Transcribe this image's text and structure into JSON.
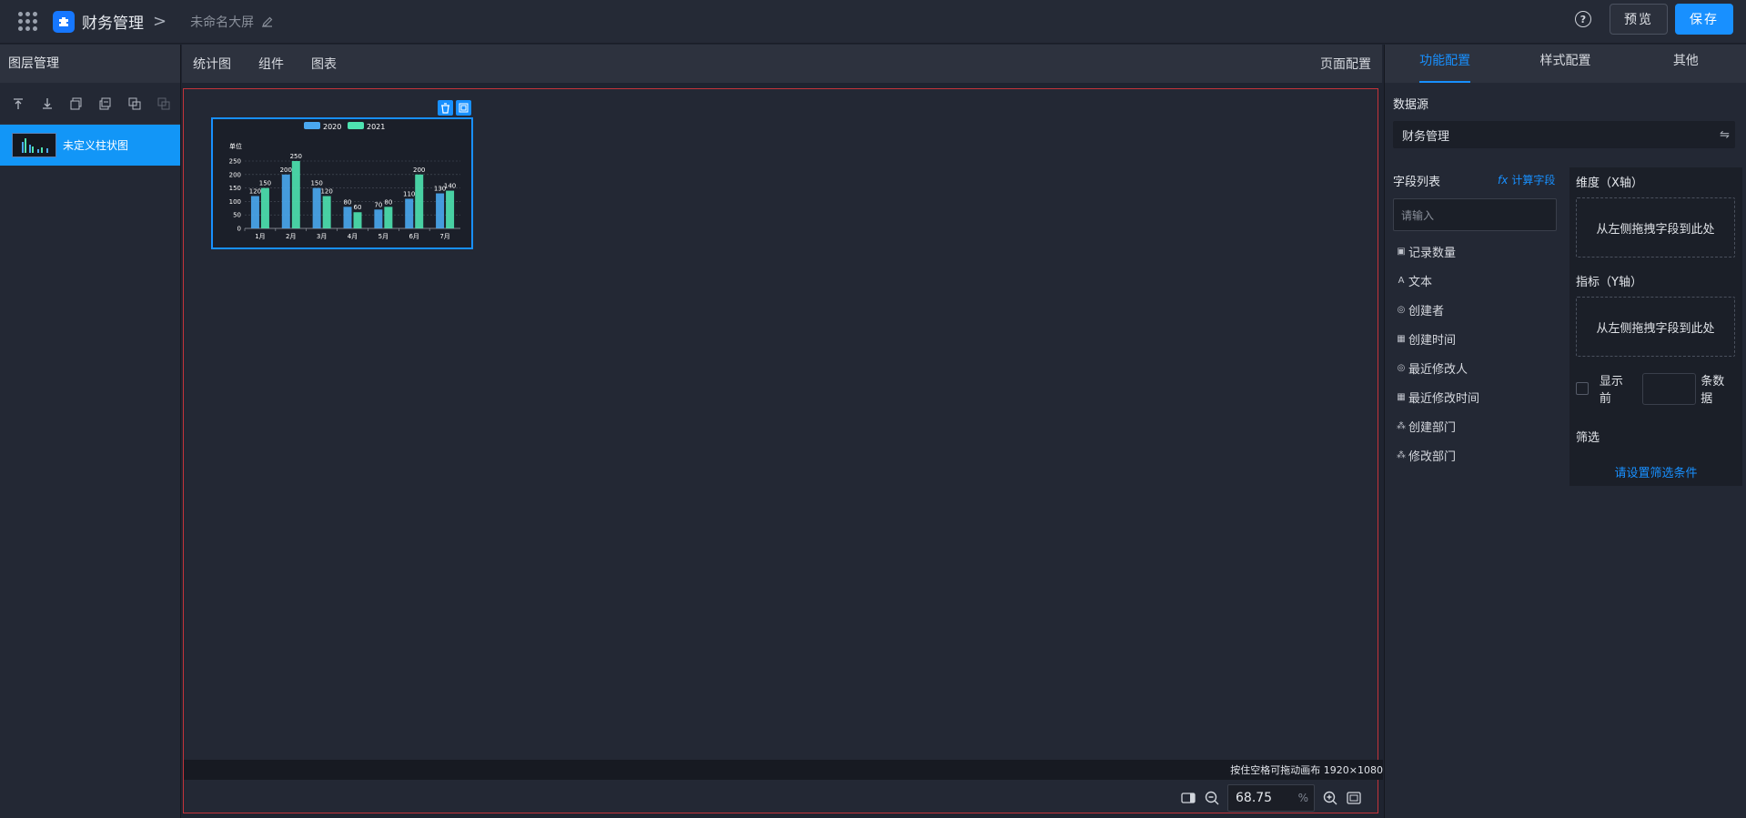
{
  "header": {
    "app_name": "财务管理",
    "screen_name": "未命名大屏",
    "preview_label": "预览",
    "save_label": "保存",
    "help_glyph": "?"
  },
  "left_panel": {
    "title": "图层管理",
    "layers": [
      {
        "name": "未定义柱状图"
      }
    ]
  },
  "center": {
    "tabs": [
      "统计图",
      "组件",
      "图表"
    ],
    "page_config_label": "页面配置",
    "status_text": "按住空格可拖动画布 1920×1080",
    "zoom_value": "68.75",
    "zoom_unit": "%"
  },
  "right_panel": {
    "tabs": [
      "功能配置",
      "样式配置",
      "其他"
    ],
    "active_tab": "功能配置",
    "datasource_label": "数据源",
    "datasource_value": "财务管理",
    "field_list_title": "字段列表",
    "calc_field_label": "计算字段",
    "calc_field_prefix": "fx",
    "search_placeholder": "请输入",
    "fields": [
      {
        "label": "记录数量",
        "icon": "count-icon"
      },
      {
        "label": "文本",
        "icon": "text-icon"
      },
      {
        "label": "创建者",
        "icon": "user-icon"
      },
      {
        "label": "创建时间",
        "icon": "calendar-icon"
      },
      {
        "label": "最近修改人",
        "icon": "user-icon"
      },
      {
        "label": "最近修改时间",
        "icon": "calendar-icon"
      },
      {
        "label": "创建部门",
        "icon": "org-icon"
      },
      {
        "label": "修改部门",
        "icon": "org-icon"
      }
    ],
    "dimension_label": "维度（X轴）",
    "dimension_drop": "从左侧拖拽字段到此处",
    "metric_label": "指标（Y轴）",
    "metric_drop": "从左侧拖拽字段到此处",
    "topn_prefix": "显示前",
    "topn_suffix": "条数据",
    "filter_label": "筛选",
    "filter_link": "请设置筛选条件"
  },
  "chart_data": {
    "type": "bar",
    "categories": [
      "1月",
      "2月",
      "3月",
      "4月",
      "5月",
      "6月",
      "7月"
    ],
    "series": [
      {
        "name": "2020",
        "values": [
          120,
          200,
          150,
          80,
          70,
          110,
          130
        ],
        "color": "#4aa8f0"
      },
      {
        "name": "2021",
        "values": [
          150,
          250,
          120,
          60,
          80,
          200,
          140
        ],
        "color": "#4ee3b0"
      }
    ],
    "ylabel": "单位",
    "ylim": [
      0,
      250
    ],
    "yticks": [
      0,
      50,
      100,
      150,
      200,
      250
    ],
    "grid": true,
    "legend_position": "top-center"
  }
}
